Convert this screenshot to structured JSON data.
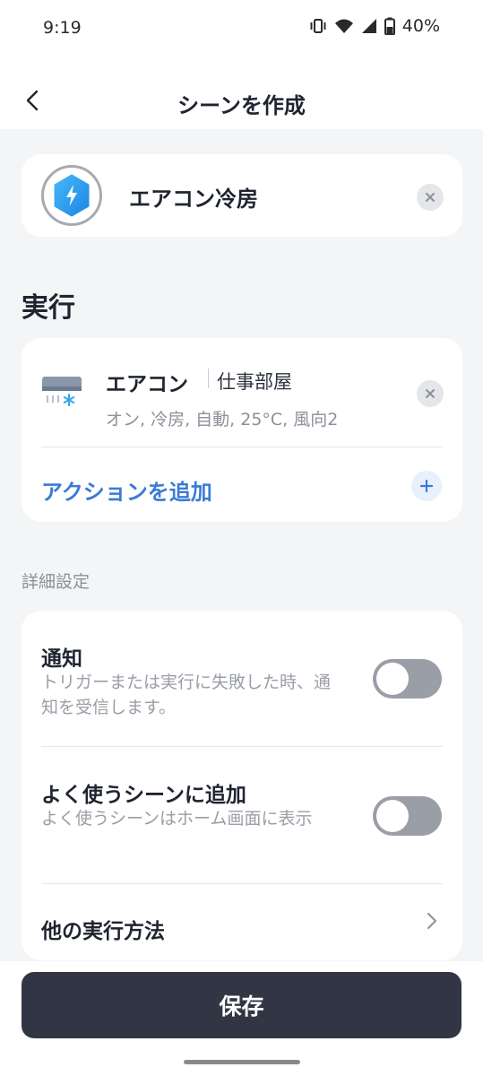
{
  "status_bar": {
    "time": "9:19",
    "battery": "40%",
    "icons": [
      "vibrate-icon",
      "wifi-icon",
      "cell-signal-icon",
      "battery-icon"
    ]
  },
  "header": {
    "title": "シーンを作成",
    "back_icon": "chevron-left-icon"
  },
  "scene": {
    "name": "エアコン冷房",
    "icon": "lightning-hexagon-icon",
    "icon_color": "#2d9cf0"
  },
  "execution": {
    "section_title": "実行",
    "device": {
      "name": "エアコン",
      "room": "仕事部屋",
      "detail": "オン, 冷房, 自動, 25°C, 風向2",
      "icon": "air-conditioner-icon"
    },
    "add_action_label": "アクションを追加",
    "accent_color": "#3a7bd5"
  },
  "advanced": {
    "label": "詳細設定",
    "notify": {
      "title": "通知",
      "description": "トリガーまたは実行に失敗した時、通知を受信します。",
      "enabled": false
    },
    "favorite": {
      "title": "よく使うシーンに追加",
      "description": "よく使うシーンはホーム画面に表示",
      "enabled": false
    },
    "other_methods": {
      "title": "他の実行方法"
    }
  },
  "footer": {
    "save_label": "保存",
    "button_color": "#323644"
  }
}
